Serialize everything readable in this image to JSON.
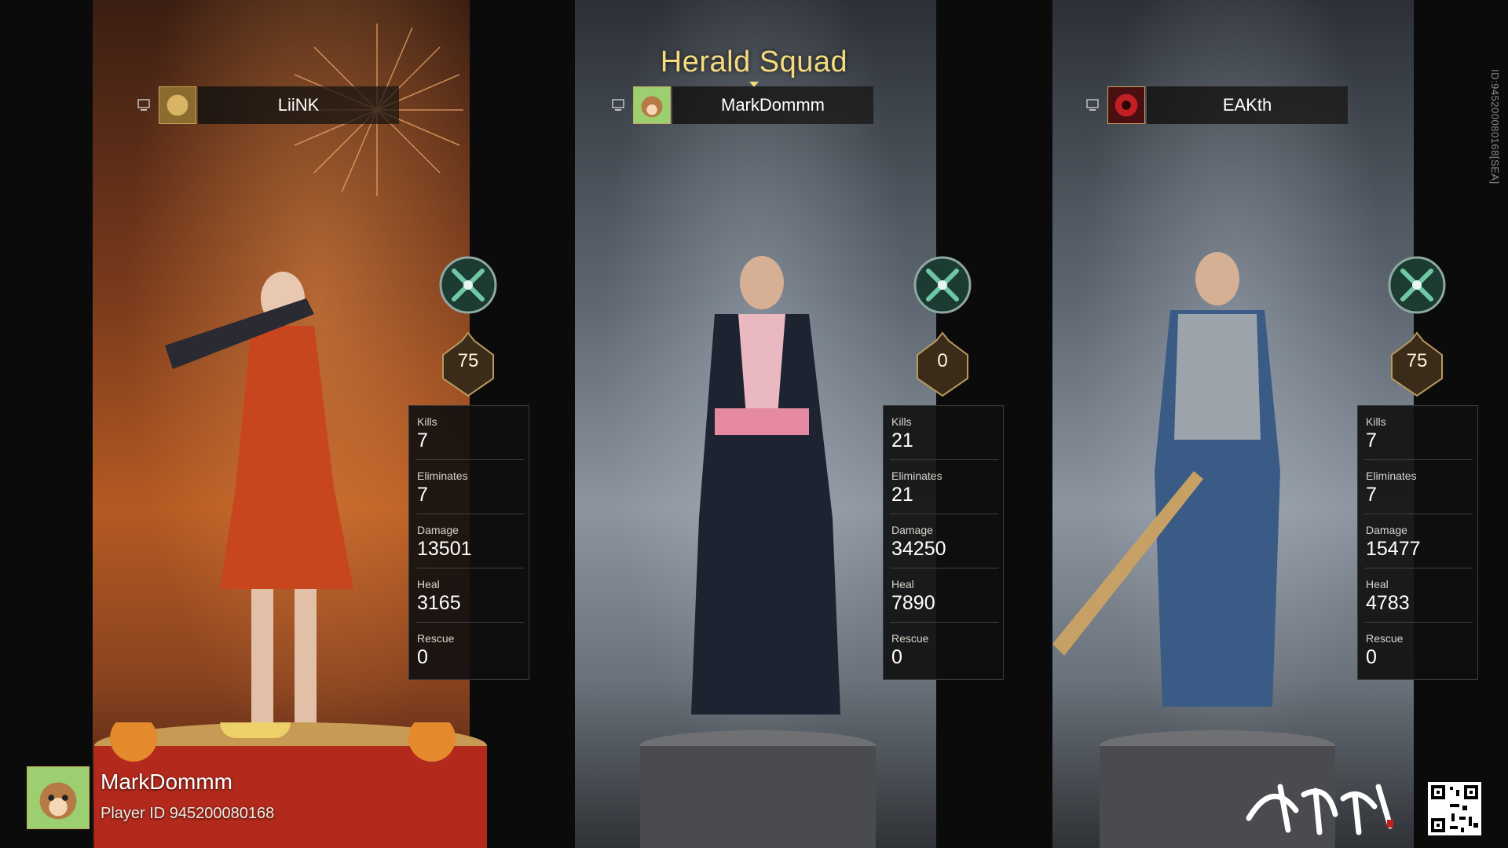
{
  "squad": {
    "title": "Herald Squad"
  },
  "watermark": {
    "id_text": "ID:945200080168[SEA]"
  },
  "players": [
    {
      "name": "LiiNK",
      "level": "75",
      "class_icon": "crossed-blades-icon",
      "stats": [
        {
          "label": "Kills",
          "value": "7"
        },
        {
          "label": "Eliminates",
          "value": "7"
        },
        {
          "label": "Damage",
          "value": "13501"
        },
        {
          "label": "Heal",
          "value": "3165"
        },
        {
          "label": "Rescue",
          "value": "0"
        }
      ]
    },
    {
      "name": "MarkDommm",
      "level": "0",
      "class_icon": "crossed-blades-icon",
      "stats": [
        {
          "label": "Kills",
          "value": "21"
        },
        {
          "label": "Eliminates",
          "value": "21"
        },
        {
          "label": "Damage",
          "value": "34250"
        },
        {
          "label": "Heal",
          "value": "7890"
        },
        {
          "label": "Rescue",
          "value": "0"
        }
      ]
    },
    {
      "name": "EAKth",
      "level": "75",
      "class_icon": "crossed-blades-icon",
      "stats": [
        {
          "label": "Kills",
          "value": "7"
        },
        {
          "label": "Eliminates",
          "value": "7"
        },
        {
          "label": "Damage",
          "value": "15477"
        },
        {
          "label": "Heal",
          "value": "4783"
        },
        {
          "label": "Rescue",
          "value": "0"
        }
      ]
    }
  ],
  "player_card": {
    "name": "MarkDommm",
    "player_id": "Player ID  945200080168"
  },
  "colors": {
    "accent_gold": "#f4dc7e",
    "class_green": "#6fc8a3",
    "panel_bg": "#0e0e0f"
  }
}
